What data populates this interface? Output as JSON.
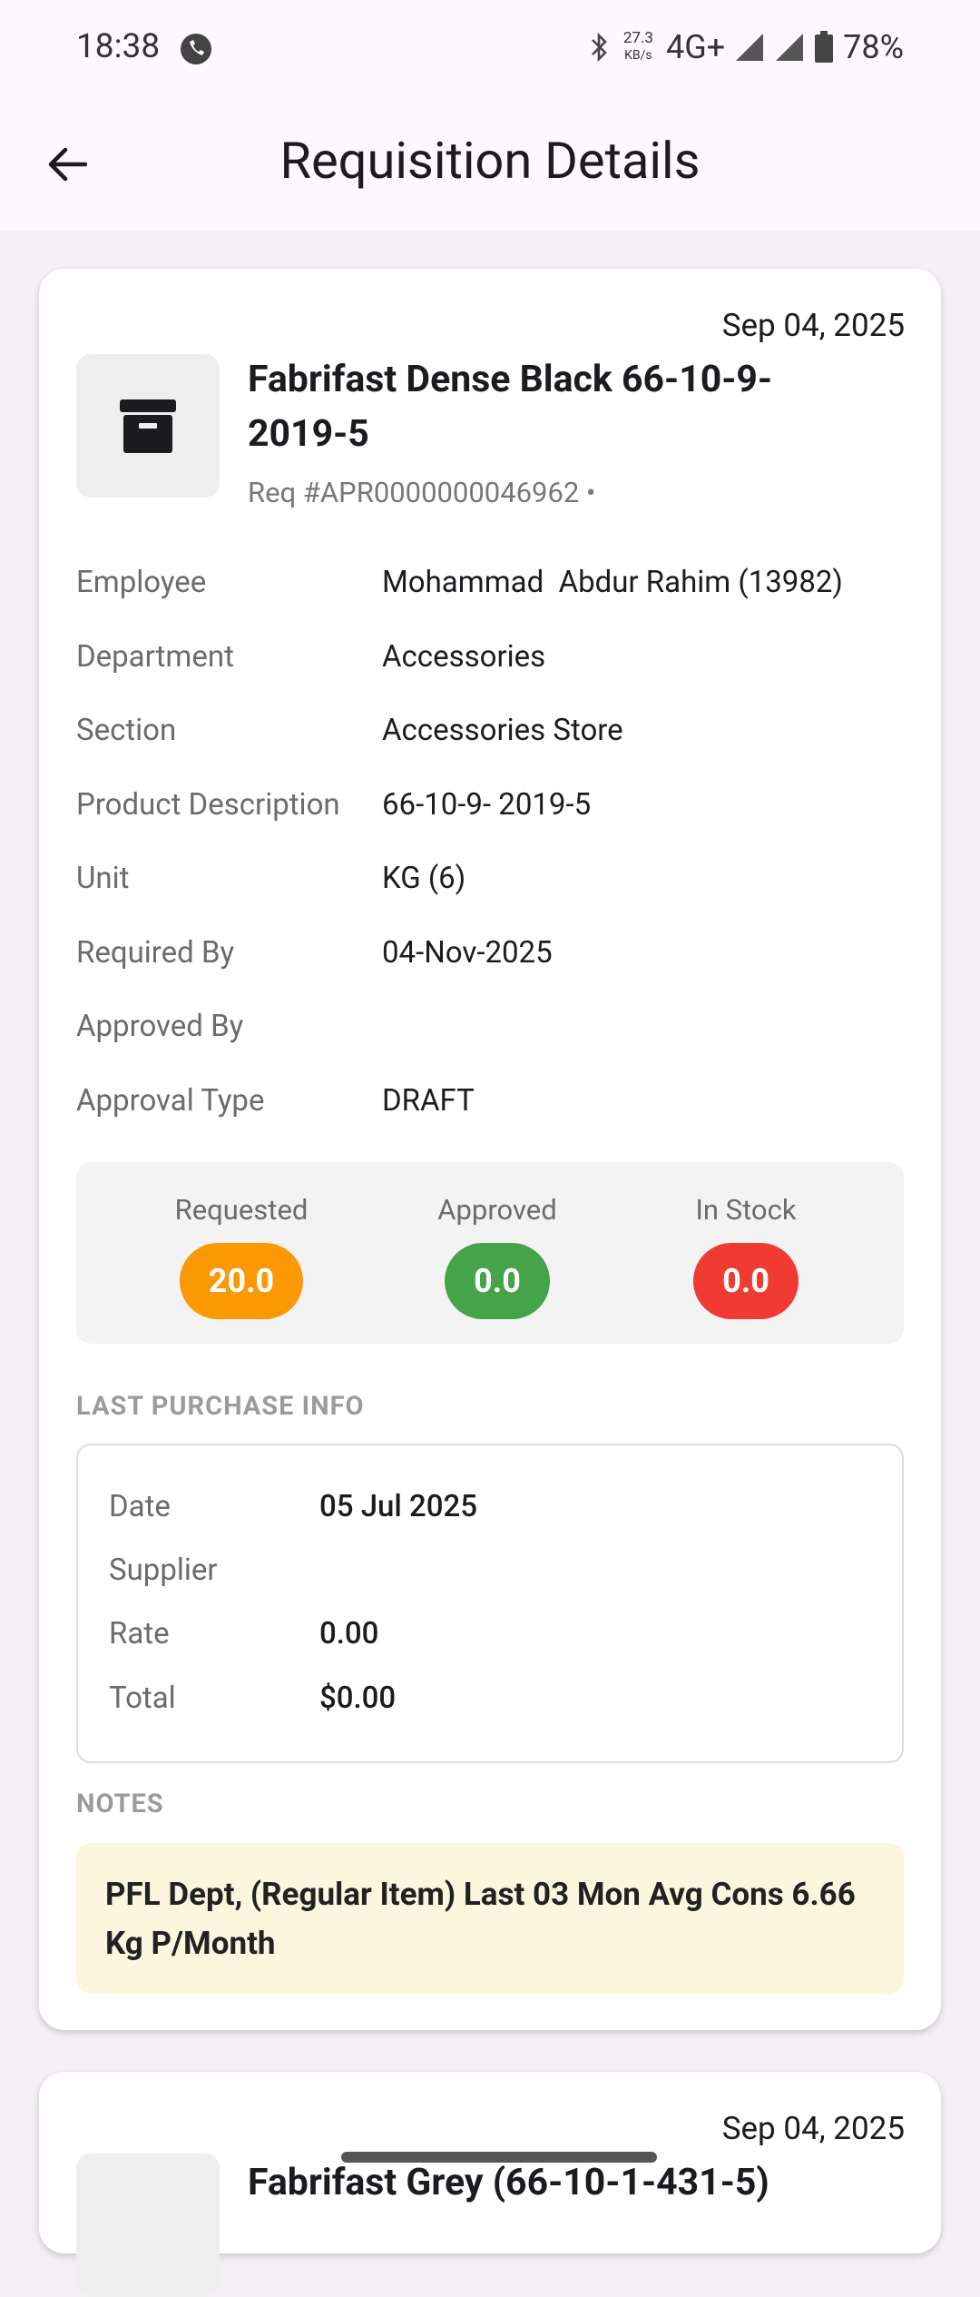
{
  "status_bar": {
    "time": "18:38",
    "net_speed": "27.3",
    "net_unit": "KB/s",
    "network": "4G+",
    "battery": "78%"
  },
  "header": {
    "title": "Requisition Details"
  },
  "requisition": {
    "date": "Sep 04, 2025",
    "title": "Fabrifast Dense Black 66-10-9-2019-5",
    "req_no": "Req #APR0000000046962 •",
    "details": [
      {
        "label": "Employee",
        "value": "Mohammad  Abdur Rahim (13982)"
      },
      {
        "label": "Department",
        "value": "Accessories"
      },
      {
        "label": "Section",
        "value": "Accessories Store"
      },
      {
        "label": "Product Description",
        "value": "66-10-9- 2019-5"
      },
      {
        "label": "Unit",
        "value": "KG (6)"
      },
      {
        "label": "Required By",
        "value": "04-Nov-2025"
      },
      {
        "label": "Approved By",
        "value": ""
      },
      {
        "label": "Approval Type",
        "value": "DRAFT"
      }
    ],
    "quantities": {
      "requested": {
        "label": "Requested",
        "value": "20.0",
        "color": "#fb9802"
      },
      "approved": {
        "label": "Approved",
        "value": "0.0",
        "color": "#45a447"
      },
      "in_stock": {
        "label": "In Stock",
        "value": "0.0",
        "color": "#f03b33"
      }
    },
    "last_purchase": {
      "heading": "LAST PURCHASE INFO",
      "rows": [
        {
          "label": "Date",
          "value": "05 Jul 2025"
        },
        {
          "label": "Supplier",
          "value": ""
        },
        {
          "label": "Rate",
          "value": "0.00"
        },
        {
          "label": "Total",
          "value": "$0.00"
        }
      ]
    },
    "notes": {
      "heading": "NOTES",
      "text": "PFL Dept, (Regular Item) Last 03 Mon Avg Cons 6.66 Kg P/Month"
    }
  },
  "next_card": {
    "date": "Sep 04, 2025",
    "title": "Fabrifast Grey (66-10-1-431-5)"
  }
}
